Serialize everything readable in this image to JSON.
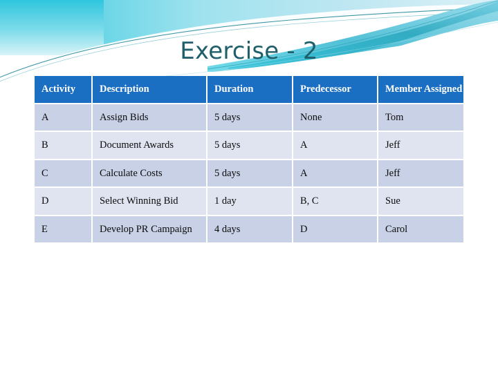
{
  "slide": {
    "title": "Exercise - 2",
    "title_color": "#1F5F6B",
    "background_color": "#FFFFFF"
  },
  "decoration": {
    "name": "wave-header-graphic",
    "colors": {
      "cyan": "#4DD8E8",
      "teal": "#2AA7BE",
      "light_blue": "#A8DCEA",
      "deep_teal": "#0E6E78",
      "pale_blue": "#CFEAF2"
    }
  },
  "table": {
    "name": "activity-table",
    "header_background": "#1B6FC2",
    "header_text_color": "#FFFFFF",
    "row_color_odd": "#C8D1E6",
    "row_color_even": "#DFE4F0",
    "columns": [
      "Activity",
      "Description",
      "Duration",
      "Predecessor",
      "Member Assigned"
    ],
    "rows": [
      {
        "activity": "A",
        "description": "Assign Bids",
        "duration": "5 days",
        "predecessor": "None",
        "member": "Tom"
      },
      {
        "activity": "B",
        "description": "Document Awards",
        "duration": "5 days",
        "predecessor": "A",
        "member": "Jeff"
      },
      {
        "activity": "C",
        "description": "Calculate Costs",
        "duration": "5 days",
        "predecessor": "A",
        "member": "Jeff"
      },
      {
        "activity": "D",
        "description": "Select Winning Bid",
        "duration": "1 day",
        "predecessor": "B, C",
        "member": "Sue"
      },
      {
        "activity": "E",
        "description": "Develop PR Campaign",
        "duration": "4 days",
        "predecessor": "D",
        "member": "Carol"
      }
    ]
  }
}
